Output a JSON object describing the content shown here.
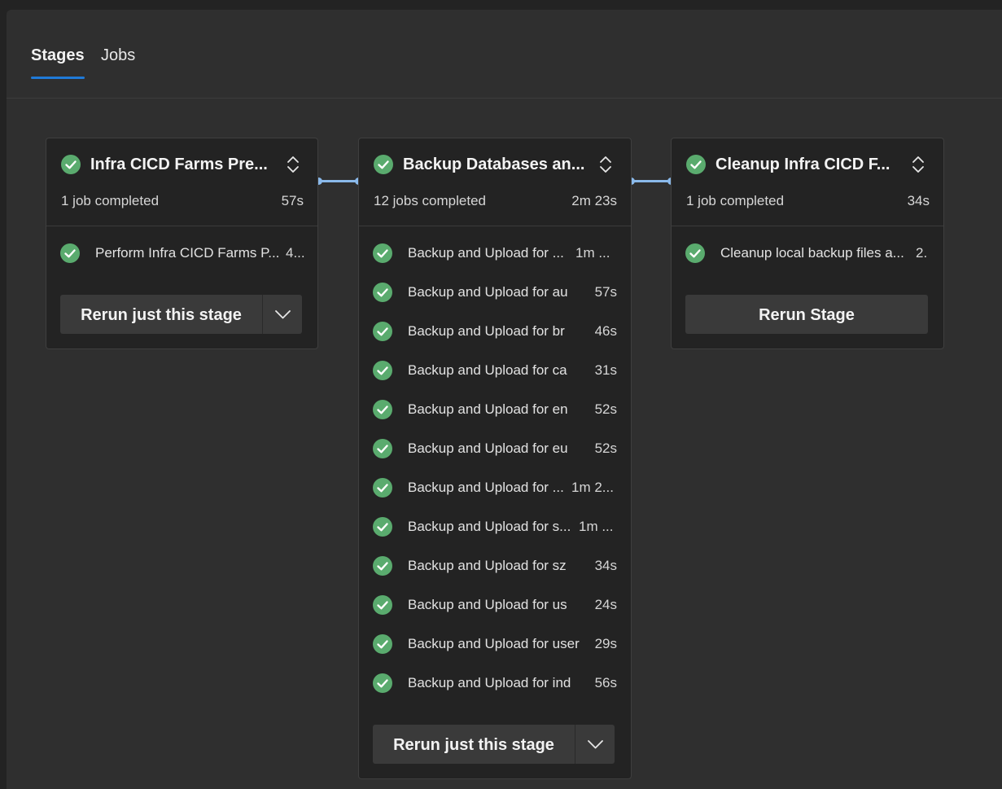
{
  "tabs": [
    {
      "label": "Stages",
      "active": true
    },
    {
      "label": "Jobs",
      "active": false
    }
  ],
  "colors": {
    "success": "#5aab6e",
    "accent": "#1f7ad8",
    "connector": "#8ab9ea"
  },
  "stages": [
    {
      "title": "Infra CICD Farms Pre...",
      "summary": "1 job completed",
      "duration": "57s",
      "status_icon": "success-check-icon",
      "jobs": [
        {
          "label": "Perform Infra CICD Farms P...",
          "time": "4..."
        }
      ],
      "rerun_label": "Rerun just this stage"
    },
    {
      "title": "Backup Databases an...",
      "summary": "12 jobs completed",
      "duration": "2m 23s",
      "status_icon": "success-check-icon",
      "jobs": [
        {
          "label": "Backup and Upload for ...",
          "time": "1m ..."
        },
        {
          "label": "Backup and Upload for au",
          "time": "57s"
        },
        {
          "label": "Backup and Upload for br",
          "time": "46s"
        },
        {
          "label": "Backup and Upload for ca",
          "time": "31s"
        },
        {
          "label": "Backup and Upload for en",
          "time": "52s"
        },
        {
          "label": "Backup and Upload for eu",
          "time": "52s"
        },
        {
          "label": "Backup and Upload for ...",
          "time": "1m 2..."
        },
        {
          "label": "Backup and Upload for s...",
          "time": "1m ..."
        },
        {
          "label": "Backup and Upload for sz",
          "time": "34s"
        },
        {
          "label": "Backup and Upload for us",
          "time": "24s"
        },
        {
          "label": "Backup and Upload for user",
          "time": "29s"
        },
        {
          "label": "Backup and Upload for ind",
          "time": "56s"
        }
      ],
      "rerun_label": "Rerun just this stage"
    },
    {
      "title": "Cleanup Infra CICD F...",
      "summary": "1 job completed",
      "duration": "34s",
      "status_icon": "success-check-icon",
      "jobs": [
        {
          "label": "Cleanup local backup files a...",
          "time": "2."
        }
      ],
      "rerun_label": "Rerun Stage"
    }
  ]
}
